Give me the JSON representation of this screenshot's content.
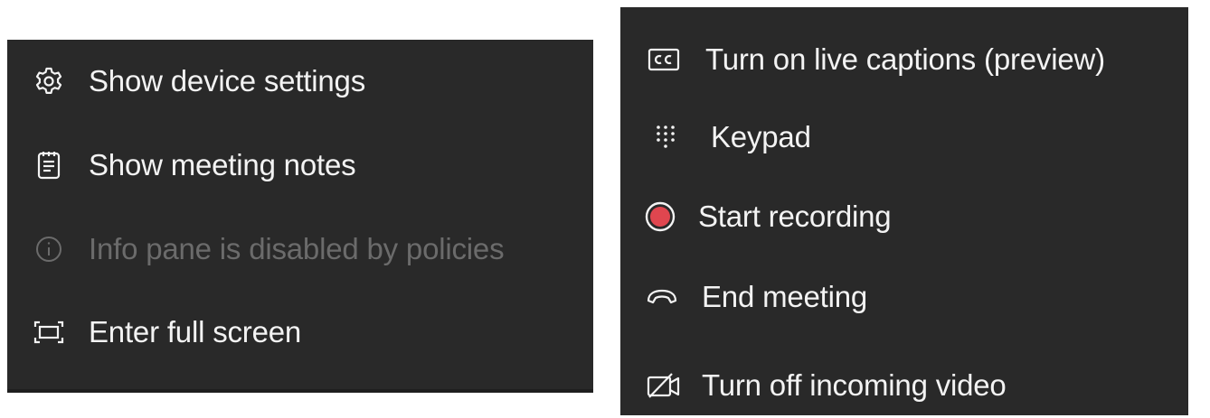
{
  "left_menu": {
    "items": [
      {
        "label": "Show device settings",
        "icon": "gear-icon",
        "disabled": false
      },
      {
        "label": "Show meeting notes",
        "icon": "notes-icon",
        "disabled": false
      },
      {
        "label": "Info pane is disabled by policies",
        "icon": "info-icon",
        "disabled": true
      },
      {
        "label": "Enter full screen",
        "icon": "fullscreen-icon",
        "disabled": false
      }
    ]
  },
  "right_menu": {
    "items": [
      {
        "label": "Turn on live captions (preview)",
        "icon": "closed-captions-icon"
      },
      {
        "label": "Keypad",
        "icon": "keypad-icon"
      },
      {
        "label": "Start recording",
        "icon": "record-icon"
      },
      {
        "label": "End meeting",
        "icon": "hang-up-icon"
      },
      {
        "label": "Turn off incoming video",
        "icon": "video-off-icon"
      }
    ]
  },
  "colors": {
    "menu_background": "#292929",
    "text": "#f3f3f3",
    "disabled_text": "#6b6b6b",
    "record_red": "#e0464f"
  }
}
